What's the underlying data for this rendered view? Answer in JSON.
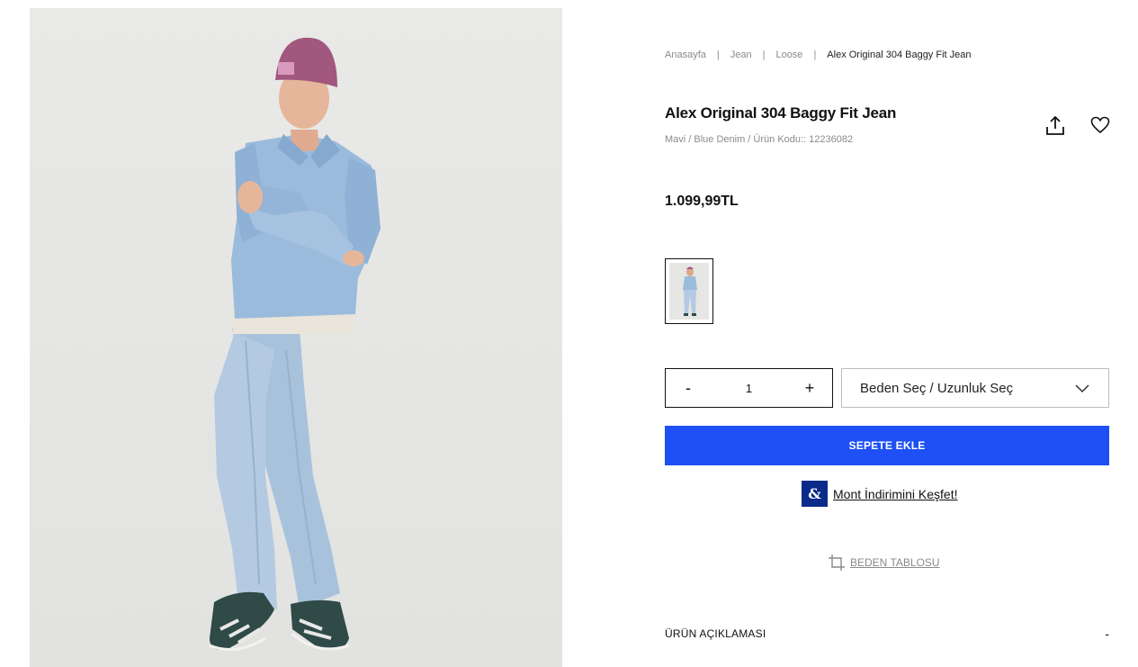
{
  "breadcrumb": {
    "items": [
      "Anasayfa",
      "Jean",
      "Loose"
    ],
    "separator": "|",
    "current": "Alex Original 304 Baggy Fit Jean"
  },
  "product": {
    "title": "Alex Original 304 Baggy Fit Jean",
    "subtitle": "Mavi / Blue Denim / Ürün Kodu:: 12236082",
    "price": "1.099,99TL"
  },
  "actions": {
    "share_icon": "share-upload-icon",
    "favorite_icon": "heart-icon"
  },
  "quantity": {
    "minus": "-",
    "value": "1",
    "plus": "+"
  },
  "size_select": {
    "placeholder": "Beden Seç / Uzunluk Seç"
  },
  "cart": {
    "add_label": "SEPETE EKLE"
  },
  "promo": {
    "logo": "&",
    "text": "Mont İndirimini Keşfet!"
  },
  "size_chart": {
    "label": "BEDEN TABLOSU"
  },
  "description": {
    "label": "ÜRÜN AÇIKLAMASI",
    "toggle": "-"
  },
  "colors": {
    "accent": "#1e50f5",
    "brand_logo_bg": "#0b2a8a",
    "muted_text": "#8a8a8a"
  }
}
